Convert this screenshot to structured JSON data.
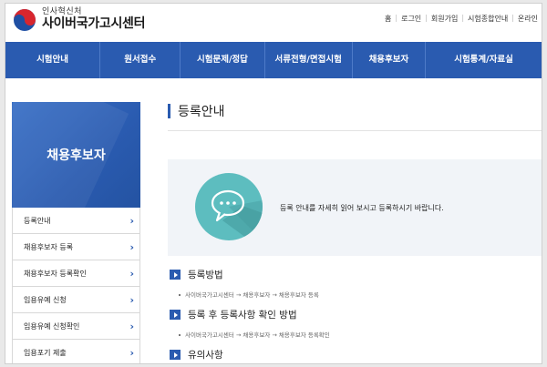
{
  "header": {
    "org_small": "인사혁신처",
    "org_big": "사이버국가고시센터",
    "util_links": [
      "홈",
      "로그인",
      "회원가입",
      "시험종합안내",
      "온라인"
    ]
  },
  "nav": {
    "items": [
      "시험안내",
      "원서접수",
      "시험문제/정답",
      "서류전형/면접시험",
      "채용후보자",
      "시험통계/자료실"
    ]
  },
  "sidebar": {
    "title": "채용후보자",
    "items": [
      "등록안내",
      "채용후보자 등록",
      "채용후보자 등록확인",
      "임용유예 신청",
      "임용유예 신청확인",
      "임용포기 제출"
    ]
  },
  "main": {
    "page_title": "등록안내",
    "notice_text": "등록 안내를 자세히 읽어 보시고 등록하시기 바랍니다.",
    "sections": [
      {
        "title": "등록방법",
        "path": "사이버국가고시센터 → 채용후보자 → 채용후보자 등록"
      },
      {
        "title": "등록 후 등록사항 확인 방법",
        "path": "사이버국가고시센터 → 채용후보자 → 채용후보자 등록확인"
      },
      {
        "title": "유의사항",
        "path": ""
      }
    ]
  },
  "colors": {
    "primary": "#2a5bb0",
    "bubble": "#5dbdbf",
    "notice_bg": "#f1f4f8"
  }
}
